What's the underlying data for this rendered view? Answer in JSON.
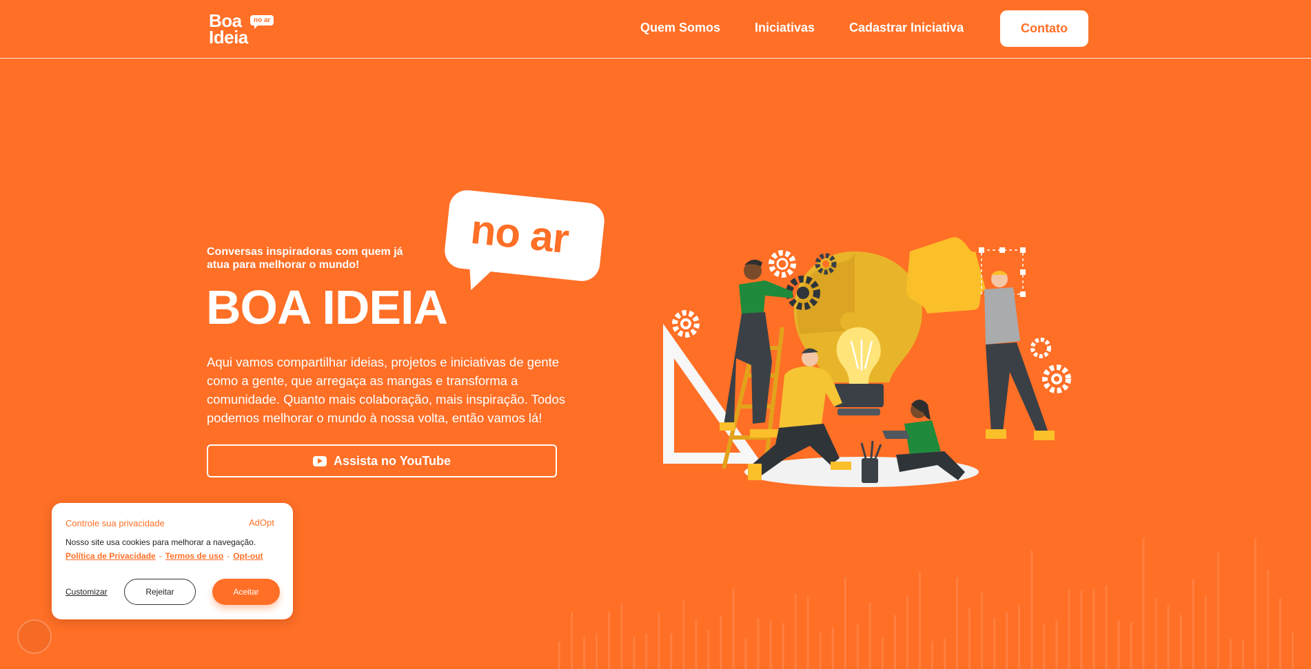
{
  "brand": {
    "logo_line1": "Boa",
    "logo_line2": "Ideia",
    "logo_tag": "no ar"
  },
  "nav": {
    "items": [
      "Quem Somos",
      "Iniciativas",
      "Cadastrar Iniciativa"
    ],
    "cta": "Contato"
  },
  "hero": {
    "subtitle": "Conversas inspiradoras com quem já atua para melhorar o mundo!",
    "title": "BOA IDEIA",
    "bubble": "no ar",
    "description": "Aqui vamos compartilhar ideias, projetos e iniciativas de gente como a gente, que arregaça as mangas e transforma a comunidade. Quanto mais colaboração, mais inspiração. Todos podemos melhorar o mundo à nossa volta, então vamos lá!",
    "youtube_button": "Assista no YouTube"
  },
  "cookie": {
    "title": "Controle sua privacidade",
    "brand": "AdOpt",
    "text": "Nosso site usa cookies para melhorar a navegação.",
    "links": [
      "Política de Privacidade",
      "Termos de uso",
      "Opt-out"
    ],
    "separator": "-",
    "customize": "Customizar",
    "reject": "Rejeitar",
    "accept": "Aceitar"
  },
  "colors": {
    "background": "#ff6f26",
    "accent_white": "#ffffff",
    "yellow": "#fbbf2a",
    "dark": "#3a4046",
    "green": "#1f8a3b"
  }
}
